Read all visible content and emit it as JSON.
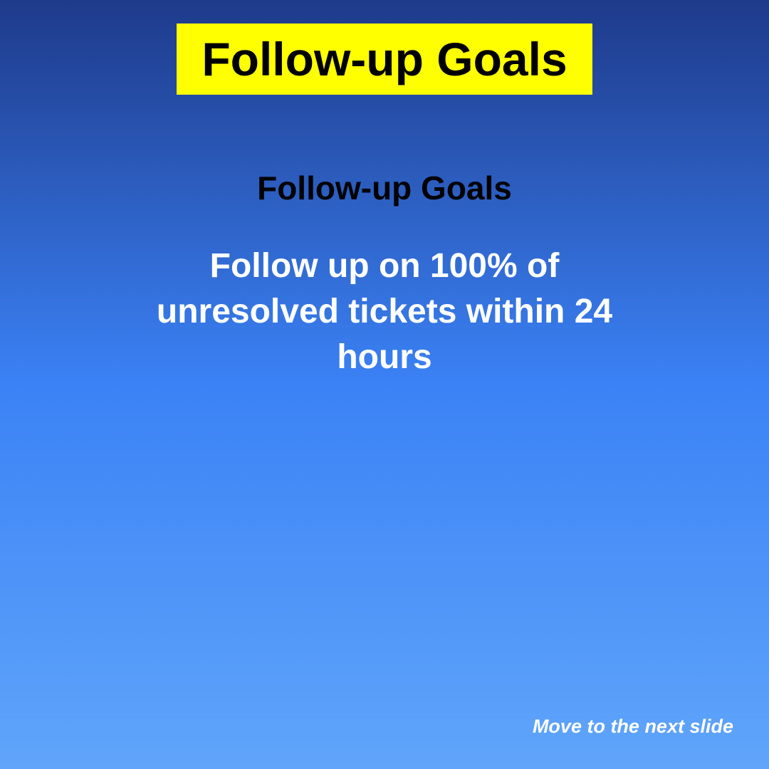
{
  "slide": {
    "title": "Follow-up Goals",
    "subtitle": "Follow-up Goals",
    "goal": "Follow up on 100% of unresolved tickets within 24 hours",
    "next_label": "Move to the next slide"
  },
  "colors": {
    "title_background": "#ffff00",
    "gradient_top": "#1e3a8a",
    "gradient_middle": "#3b82f6",
    "gradient_bottom": "#60a5fa",
    "title_text": "#000000",
    "subtitle_text": "#000000",
    "goal_text": "#ffffff",
    "link_text": "#ffffff"
  }
}
